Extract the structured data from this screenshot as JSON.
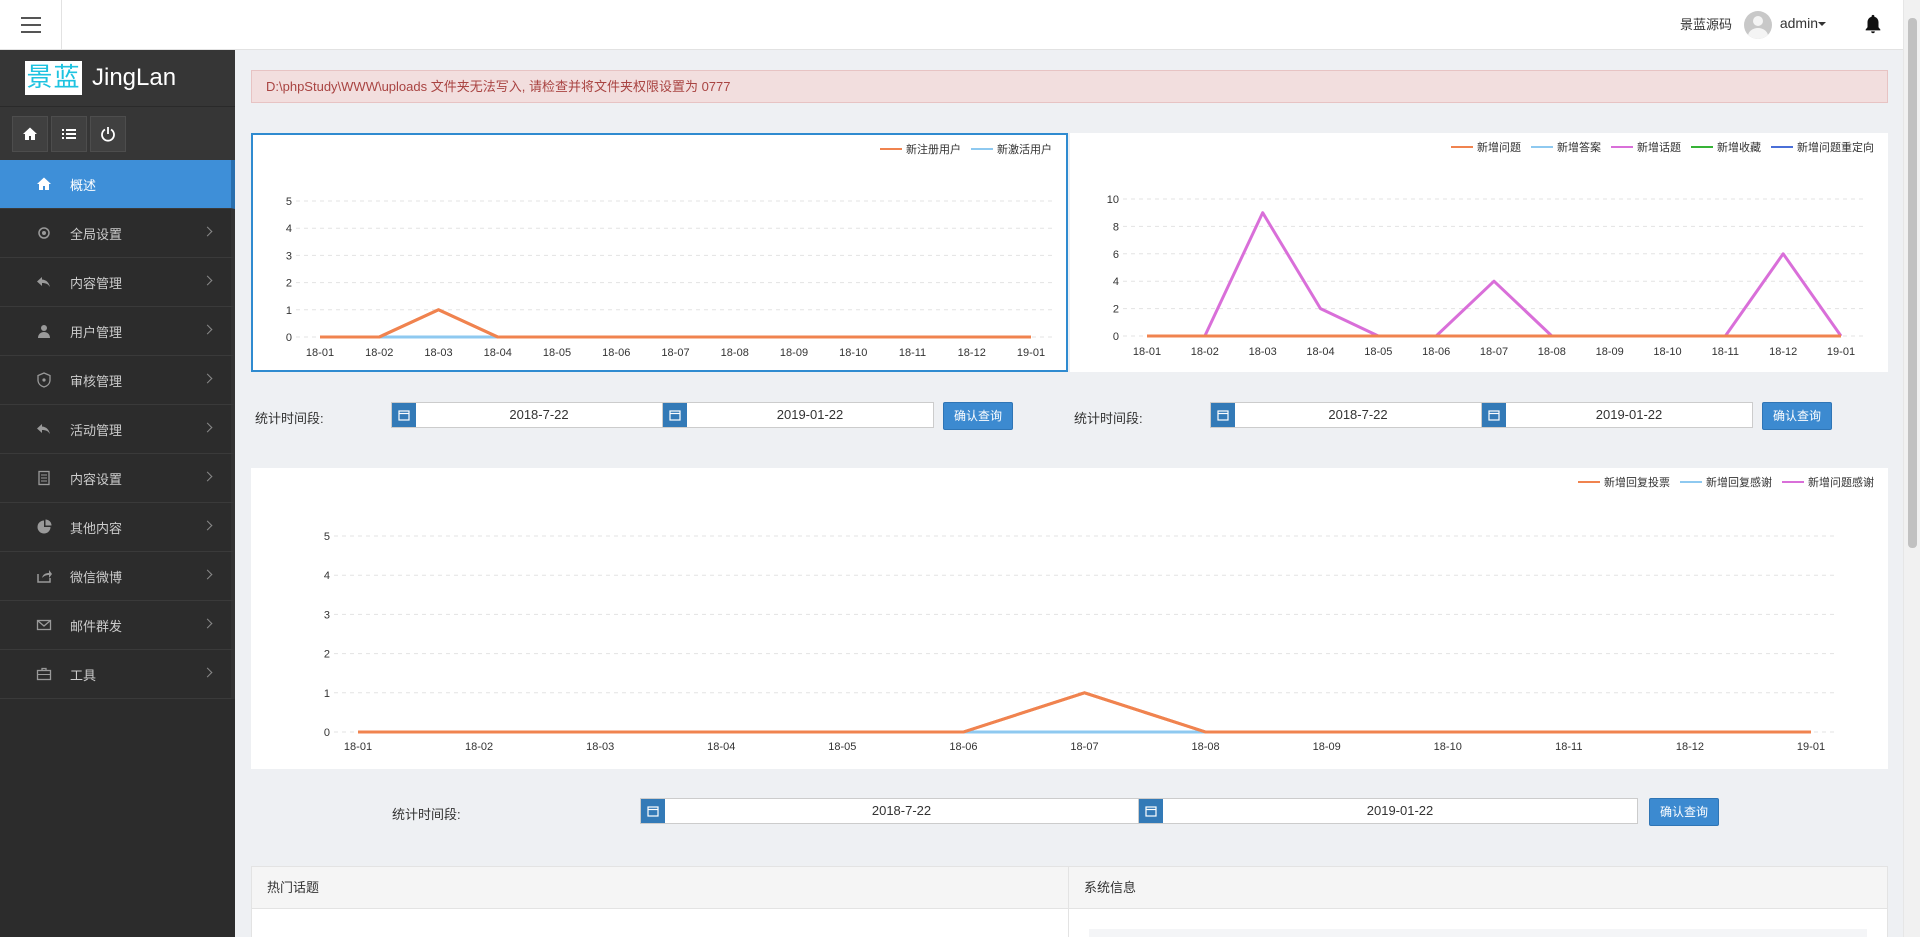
{
  "topbar": {
    "site_name": "景蓝源码",
    "user_name": "admin"
  },
  "sidebar": {
    "logo_text": "景蓝",
    "brand": "JingLan",
    "items": [
      {
        "label": "概述",
        "icon": "home-icon",
        "active": true
      },
      {
        "label": "全局设置",
        "icon": "gear-icon"
      },
      {
        "label": "内容管理",
        "icon": "reply-arrow-icon"
      },
      {
        "label": "用户管理",
        "icon": "user-icon"
      },
      {
        "label": "审核管理",
        "icon": "shield-icon"
      },
      {
        "label": "活动管理",
        "icon": "reply-arrow-icon"
      },
      {
        "label": "内容设置",
        "icon": "document-icon"
      },
      {
        "label": "其他内容",
        "icon": "pie-icon"
      },
      {
        "label": "微信微博",
        "icon": "share-icon"
      },
      {
        "label": "邮件群发",
        "icon": "mail-icon"
      },
      {
        "label": "工具",
        "icon": "briefcase-icon"
      }
    ]
  },
  "alert": {
    "text": "D:\\phpStudy\\WWW\\uploads 文件夹无法写入, 请检查并将文件夹权限设置为 0777"
  },
  "queries": [
    {
      "label": "统计时间段:",
      "start": "2018-7-22",
      "end": "2019-01-22",
      "button": "确认查询"
    },
    {
      "label": "统计时间段:",
      "start": "2018-7-22",
      "end": "2019-01-22",
      "button": "确认查询"
    },
    {
      "label": "统计时间段:",
      "start": "2018-7-22",
      "end": "2019-01-22",
      "button": "确认查询"
    }
  ],
  "bottom": {
    "hot_topics": "热门话题",
    "system_info": "系统信息"
  },
  "chart_data": [
    {
      "type": "line",
      "x": [
        "18-01",
        "18-02",
        "18-03",
        "18-04",
        "18-05",
        "18-06",
        "18-07",
        "18-08",
        "18-09",
        "18-10",
        "18-11",
        "18-12",
        "19-01"
      ],
      "ylim": [
        0,
        5
      ],
      "yticks": [
        0,
        1,
        2,
        3,
        4,
        5
      ],
      "grid": true,
      "legend_position": "top-right",
      "series": [
        {
          "name": "新注册用户",
          "color": "#f0834f",
          "values": [
            0,
            0,
            1,
            0,
            0,
            0,
            0,
            0,
            0,
            0,
            0,
            0,
            0
          ]
        },
        {
          "name": "新激活用户",
          "color": "#8ec9f0",
          "values": [
            0,
            0,
            0,
            0,
            0,
            0,
            0,
            0,
            0,
            0,
            0,
            0,
            0
          ]
        }
      ]
    },
    {
      "type": "line",
      "x": [
        "18-01",
        "18-02",
        "18-03",
        "18-04",
        "18-05",
        "18-06",
        "18-07",
        "18-08",
        "18-09",
        "18-10",
        "18-11",
        "18-12",
        "19-01"
      ],
      "ylim": [
        0,
        10
      ],
      "yticks": [
        0,
        2,
        4,
        6,
        8,
        10
      ],
      "grid": true,
      "legend_position": "top-right",
      "series": [
        {
          "name": "新增问题",
          "color": "#f0834f",
          "values": [
            0,
            0,
            0,
            0,
            0,
            0,
            0,
            0,
            0,
            0,
            0,
            0,
            0
          ]
        },
        {
          "name": "新增答案",
          "color": "#8ec9f0",
          "values": [
            0,
            0,
            0,
            0,
            0,
            0,
            0,
            0,
            0,
            0,
            0,
            0,
            0
          ]
        },
        {
          "name": "新增话题",
          "color": "#d96fd9",
          "values": [
            0,
            0,
            9,
            2,
            0,
            0,
            4,
            0,
            0,
            0,
            0,
            6,
            0
          ]
        },
        {
          "name": "新增收藏",
          "color": "#36b336",
          "values": [
            0,
            0,
            0,
            0,
            0,
            0,
            0,
            0,
            0,
            0,
            0,
            0,
            0
          ]
        },
        {
          "name": "新增问题重定向",
          "color": "#4a6fd8",
          "values": [
            0,
            0,
            0,
            0,
            0,
            0,
            0,
            0,
            0,
            0,
            0,
            0,
            0
          ]
        }
      ]
    },
    {
      "type": "line",
      "x": [
        "18-01",
        "18-02",
        "18-03",
        "18-04",
        "18-05",
        "18-06",
        "18-07",
        "18-08",
        "18-09",
        "18-10",
        "18-11",
        "18-12",
        "19-01"
      ],
      "ylim": [
        0,
        5
      ],
      "yticks": [
        0,
        1,
        2,
        3,
        4,
        5
      ],
      "grid": true,
      "legend_position": "top-right",
      "series": [
        {
          "name": "新增回复投票",
          "color": "#f0834f",
          "values": [
            0,
            0,
            0,
            0,
            0,
            0,
            1,
            0,
            0,
            0,
            0,
            0,
            0
          ]
        },
        {
          "name": "新增回复感谢",
          "color": "#8ec9f0",
          "values": [
            0,
            0,
            0,
            0,
            0,
            0,
            0,
            0,
            0,
            0,
            0,
            0,
            0
          ]
        },
        {
          "name": "新增问题感谢",
          "color": "#d96fd9",
          "values": [
            0,
            0,
            0,
            0,
            0,
            0,
            0,
            0,
            0,
            0,
            0,
            0,
            0
          ]
        }
      ]
    }
  ]
}
